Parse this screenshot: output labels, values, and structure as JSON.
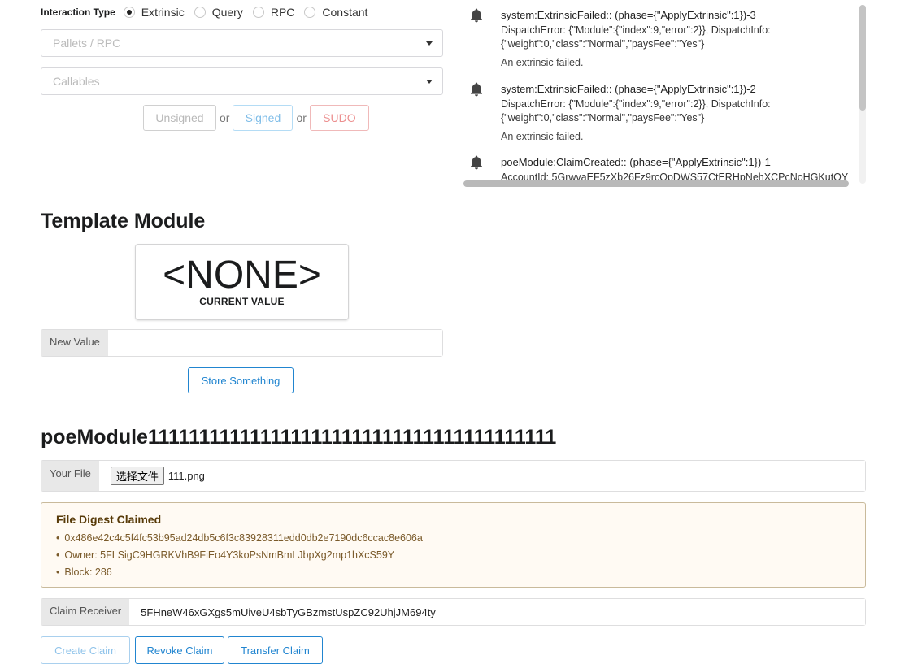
{
  "interaction": {
    "label": "Interaction Type",
    "options": [
      "Extrinsic",
      "Query",
      "RPC",
      "Constant"
    ],
    "selected": "Extrinsic"
  },
  "pallets_placeholder": "Pallets / RPC",
  "callables_placeholder": "Callables",
  "sign_buttons": {
    "unsigned": "Unsigned",
    "signed": "Signed",
    "sudo": "SUDO",
    "or": "or"
  },
  "events": [
    {
      "title": "system:ExtrinsicFailed:: (phase={\"ApplyExtrinsic\":1})-3",
      "body": "DispatchError: {\"Module\":{\"index\":9,\"error\":2}}, DispatchInfo: {\"weight\":0,\"class\":\"Normal\",\"paysFee\":\"Yes\"}",
      "desc": "An extrinsic failed."
    },
    {
      "title": "system:ExtrinsicFailed:: (phase={\"ApplyExtrinsic\":1})-2",
      "body": "DispatchError: {\"Module\":{\"index\":9,\"error\":2}}, DispatchInfo: {\"weight\":0,\"class\":\"Normal\",\"paysFee\":\"Yes\"}",
      "desc": "An extrinsic failed."
    },
    {
      "title": "poeModule:ClaimCreated:: (phase={\"ApplyExtrinsic\":1})-1",
      "body": "AccountId: 5GrwvaEF5zXb26Fz9rcQpDWS57CtERHpNehXCPcNoHGKutQY",
      "desc": ""
    }
  ],
  "template": {
    "title": "Template Module",
    "value": "<NONE>",
    "value_caption": "CURRENT VALUE",
    "new_value_label": "New Value",
    "store_button": "Store Something"
  },
  "poe": {
    "title": "poeModule1111111111111111111111111111111111111111",
    "file_label": "Your File",
    "file_button": "选择文件",
    "file_name": "111.png",
    "digest_header": "File Digest Claimed",
    "digest_items": [
      "0x486e42c4c5f4fc53b95ad24db5c6f3c83928311edd0db2e7190dc6ccac8e606a",
      "Owner: 5FLSigC9HGRKVhB9FiEo4Y3koPsNmBmLJbpXg2mp1hXcS59Y",
      "Block: 286"
    ],
    "receiver_label": "Claim Receiver",
    "receiver_value": "5FHneW46xGXgs5mUiveU4sbTyGBzmstUspZC92UhjJM694ty",
    "buttons": {
      "create": "Create Claim",
      "revoke": "Revoke Claim",
      "transfer": "Transfer Claim"
    }
  },
  "colors": {
    "accent": "#2185d0",
    "sudo": "#db2828",
    "signed": "#54c8ff"
  }
}
